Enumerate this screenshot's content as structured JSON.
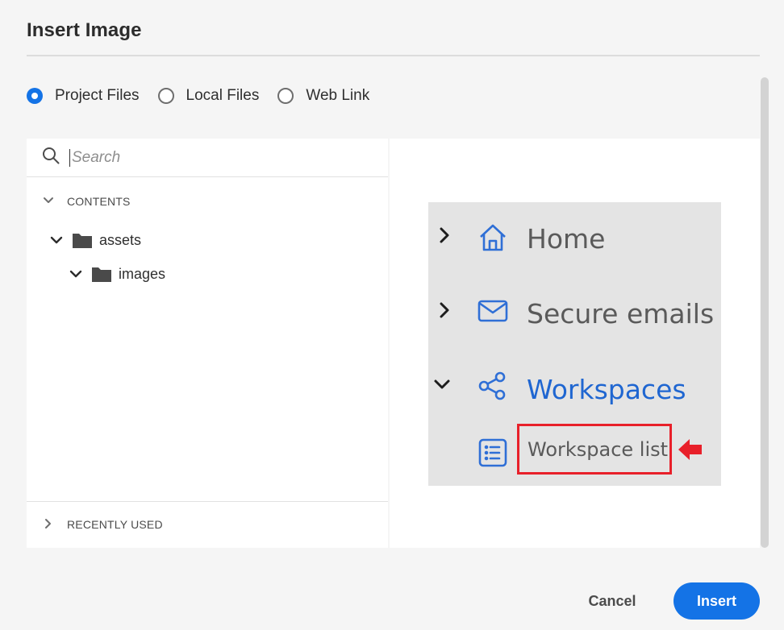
{
  "dialog": {
    "title": "Insert Image"
  },
  "source_options": [
    {
      "label": "Project Files",
      "selected": true
    },
    {
      "label": "Local Files",
      "selected": false
    },
    {
      "label": "Web Link",
      "selected": false
    }
  ],
  "search": {
    "placeholder": "Search",
    "value": ""
  },
  "tree": {
    "contents_label": "CONTENTS",
    "nodes": [
      {
        "label": "assets",
        "expanded": true
      },
      {
        "label": "images",
        "expanded": true
      }
    ],
    "recently_used_label": "RECENTLY USED"
  },
  "preview": {
    "items": [
      {
        "label": "Home",
        "icon": "home-icon",
        "expanded": false
      },
      {
        "label": "Secure emails",
        "icon": "mail-icon",
        "expanded": false
      },
      {
        "label": "Workspaces",
        "icon": "share-icon",
        "expanded": true
      },
      {
        "label": "Workspace list",
        "icon": "list-icon"
      }
    ],
    "colors": {
      "background": "#e4e4e4",
      "link_blue": "#1f66d1",
      "icon_blue": "#2f6fd6",
      "text_grey": "#5a5a5a",
      "highlight_red": "#e8202a"
    }
  },
  "actions": {
    "cancel_label": "Cancel",
    "insert_label": "Insert"
  },
  "colors": {
    "accent": "#1473e6",
    "panel_bg": "#ffffff",
    "dialog_bg": "#f5f5f5"
  }
}
